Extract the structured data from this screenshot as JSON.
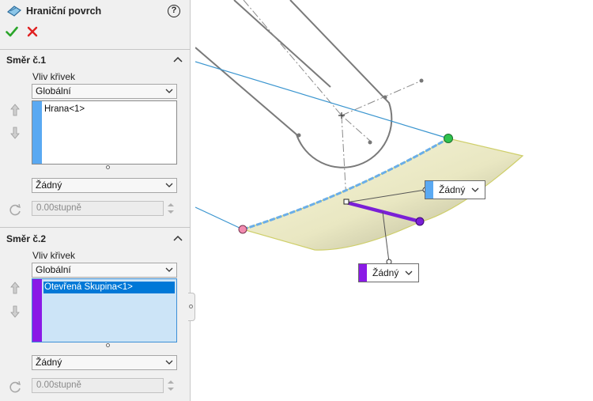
{
  "panel": {
    "title": "Hraniční povrch",
    "icons": {
      "feature": "boundary-surface-icon",
      "help": "help-icon",
      "ok": "checkmark-icon",
      "cancel": "close-icon"
    },
    "help_glyph": "?"
  },
  "direction1": {
    "title": "Směr č.1",
    "curve_influence_label": "Vliv křivek",
    "curve_influence_value": "Globální",
    "items": [
      "Hrana<1>"
    ],
    "strip_color": "#5aa9f2",
    "tangency_value": "Žádný",
    "angle_value": "0.00stupně"
  },
  "direction2": {
    "title": "Směr č.2",
    "curve_influence_label": "Vliv křivek",
    "curve_influence_value": "Globální",
    "items": [
      "Otevřená Skupina<1>"
    ],
    "strip_color": "#8a1ae6",
    "tangency_value": "Žádný",
    "angle_value": "0.00stupně"
  },
  "callouts": [
    {
      "label": "Žádný",
      "color": "#5aa9f2"
    },
    {
      "label": "Žádný",
      "color": "#8a1ae6"
    }
  ],
  "colors": {
    "accent_blue": "#0078d7",
    "ok_green": "#2aa52a",
    "cancel_red": "#e02020",
    "surface": "#f3f1c8",
    "edge_blue": "#6aaee8",
    "edge_purple": "#7a1fd6"
  }
}
